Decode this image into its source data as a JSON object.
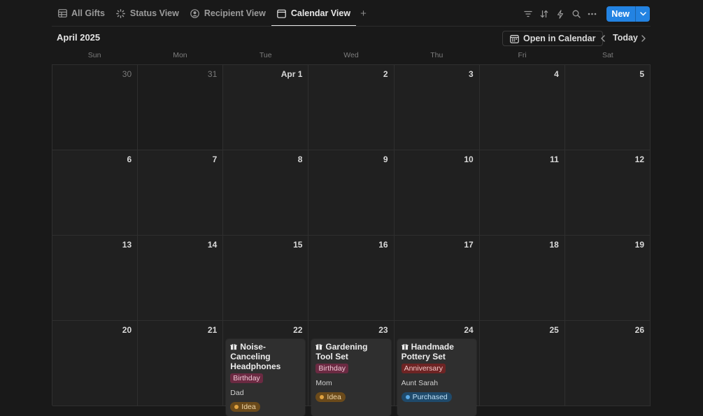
{
  "tabs": [
    {
      "label": "All Gifts",
      "icon": "table-icon"
    },
    {
      "label": "Status View",
      "icon": "loading-icon"
    },
    {
      "label": "Recipient View",
      "icon": "person-circle-icon"
    },
    {
      "label": "Calendar View",
      "icon": "calendar-icon",
      "active": true
    }
  ],
  "toolbar": {
    "new_label": "New",
    "icons": [
      "filter-icon",
      "sort-icon",
      "lightning-icon",
      "search-icon",
      "more-icon",
      "chevron-down-icon"
    ]
  },
  "calendar": {
    "month_title": "April 2025",
    "open_in_calendar": "Open in Calendar",
    "today_label": "Today",
    "weekdays": [
      "Sun",
      "Mon",
      "Tue",
      "Wed",
      "Thu",
      "Fri",
      "Sat"
    ],
    "weeks": [
      [
        {
          "day": "30",
          "out": true
        },
        {
          "day": "31",
          "out": true
        },
        {
          "day": "Apr 1"
        },
        {
          "day": "2"
        },
        {
          "day": "3"
        },
        {
          "day": "4"
        },
        {
          "day": "5"
        }
      ],
      [
        {
          "day": "6"
        },
        {
          "day": "7"
        },
        {
          "day": "8"
        },
        {
          "day": "9"
        },
        {
          "day": "10"
        },
        {
          "day": "11"
        },
        {
          "day": "12"
        }
      ],
      [
        {
          "day": "13"
        },
        {
          "day": "14"
        },
        {
          "day": "15"
        },
        {
          "day": "16"
        },
        {
          "day": "17"
        },
        {
          "day": "18"
        },
        {
          "day": "19"
        }
      ],
      [
        {
          "day": "20"
        },
        {
          "day": "21"
        },
        {
          "day": "22",
          "event": {
            "title": "Noise-Canceling Headphones",
            "tag": "Birthday",
            "tag_style": "birthday",
            "recipient": "Dad",
            "status": "Idea",
            "status_style": "idea"
          }
        },
        {
          "day": "23",
          "event": {
            "title": "Gardening Tool Set",
            "tag": "Birthday",
            "tag_style": "birthday",
            "recipient": "Mom",
            "status": "Idea",
            "status_style": "idea"
          }
        },
        {
          "day": "24",
          "event": {
            "title": "Handmade Pottery Set",
            "tag": "Anniversary",
            "tag_style": "anniversary",
            "recipient": "Aunt Sarah",
            "status": "Purchased",
            "status_style": "purchased"
          }
        },
        {
          "day": "25"
        },
        {
          "day": "26"
        }
      ]
    ]
  },
  "colors": {
    "background": "#191919",
    "accent": "#2383e2",
    "birthday_tag": "#6b2a42",
    "anniversary_tag": "#6e2424",
    "idea_status": "#6b4a1a",
    "purchased_status": "#1f4a6b"
  }
}
